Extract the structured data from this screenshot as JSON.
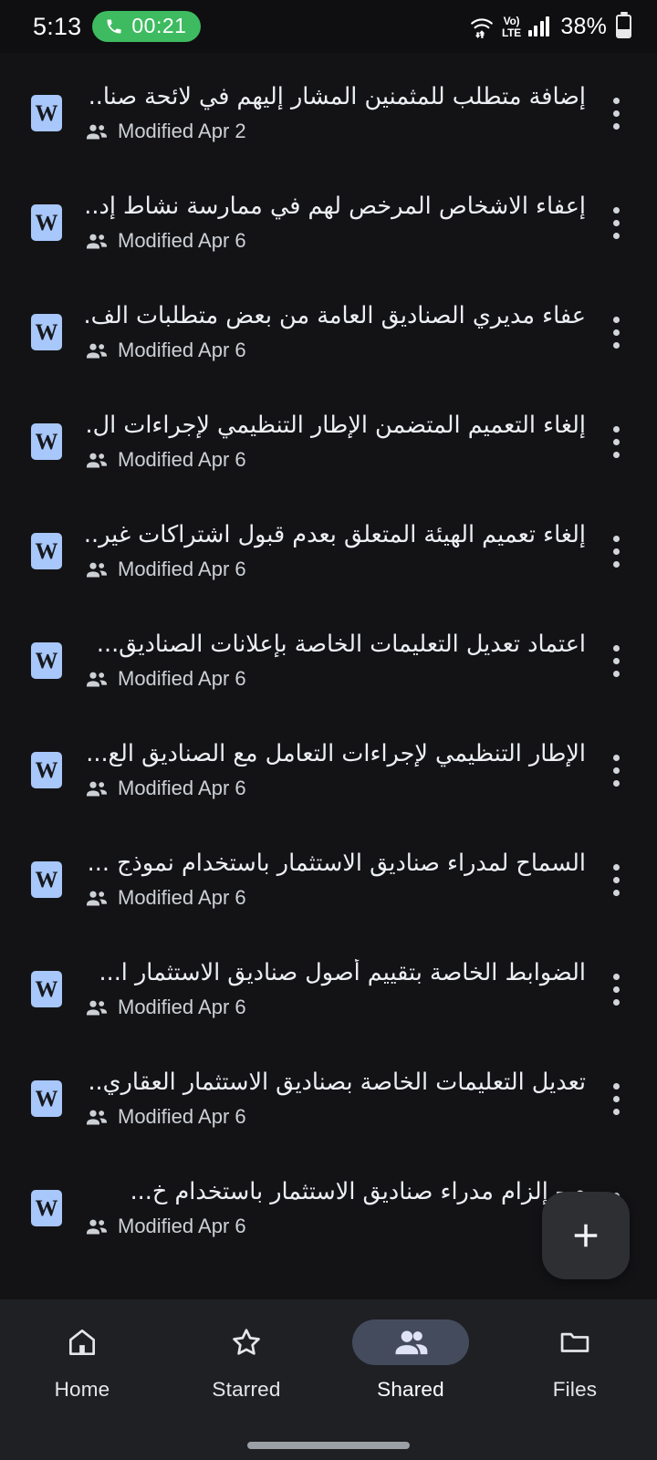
{
  "status_bar": {
    "clock": "5:13",
    "call_timer": "00:21",
    "call_pill_color": "#3ebb60",
    "volte_line1": "Vo)",
    "volte_line2": "LTE",
    "battery_percent": "38%",
    "battery_level": 38,
    "icons": [
      "phone-icon",
      "wifi-icon",
      "volte-icon",
      "signal-bars-icon",
      "battery-icon"
    ]
  },
  "file_list": {
    "doc_icon_letter": "W",
    "doc_icon_color": "#a8c7fa",
    "items": [
      {
        "title": "إضافة متطلب للمثمنين المشار إليهم في لائحة صنا...",
        "meta": "Modified Apr 2"
      },
      {
        "title": "إعفاء الاشخاص المرخص لهم في ممارسة نشاط إد...",
        "meta": "Modified Apr 6"
      },
      {
        "title": "عفاء مديري الصناديق العامة من بعض متطلبات الف...",
        "meta": "Modified Apr 6"
      },
      {
        "title": "إلغاء التعميم المتضمن الإطار التنظيمي لإجراءات ال...",
        "meta": "Modified Apr 6"
      },
      {
        "title": "إلغاء تعميم الهيئة المتعلق بعدم قبول اشتراكات غير...",
        "meta": "Modified Apr 6"
      },
      {
        "title": "اعتماد تعديل التعليمات الخاصة بإعلانات الصناديق...",
        "meta": "Modified Apr 6"
      },
      {
        "title": "الإطار التنظيمي لإجراءات التعامل مع الصناديق الع...",
        "meta": "Modified Apr 6"
      },
      {
        "title": "السماح لمدراء صناديق الاستثمار باستخدام نموذج ...",
        "meta": "Modified Apr 6"
      },
      {
        "title": "الضوابط الخاصة بتقييم أصول صناديق الاستثمار ا...",
        "meta": "Modified Apr 6"
      },
      {
        "title": "تعديل التعليمات الخاصة بصناديق الاستثمار العقاري...",
        "meta": "Modified Apr 6"
      },
      {
        "title": "م - إلزام مدراء صناديق الاستثمار باستخدام خ...",
        "meta": "Modified Apr 6"
      }
    ],
    "row_menu_icon": "kebab-menu-icon",
    "meta_icon": "people-shared-icon"
  },
  "fab": {
    "label": "+",
    "icon": "plus-icon",
    "background": "#2e2f33"
  },
  "bottom_nav": {
    "active_index": 2,
    "active_pill_color": "#444b5c",
    "tabs": [
      {
        "label": "Home",
        "icon": "home-icon"
      },
      {
        "label": "Starred",
        "icon": "star-icon"
      },
      {
        "label": "Shared",
        "icon": "people-icon"
      },
      {
        "label": "Files",
        "icon": "folder-icon"
      }
    ]
  }
}
